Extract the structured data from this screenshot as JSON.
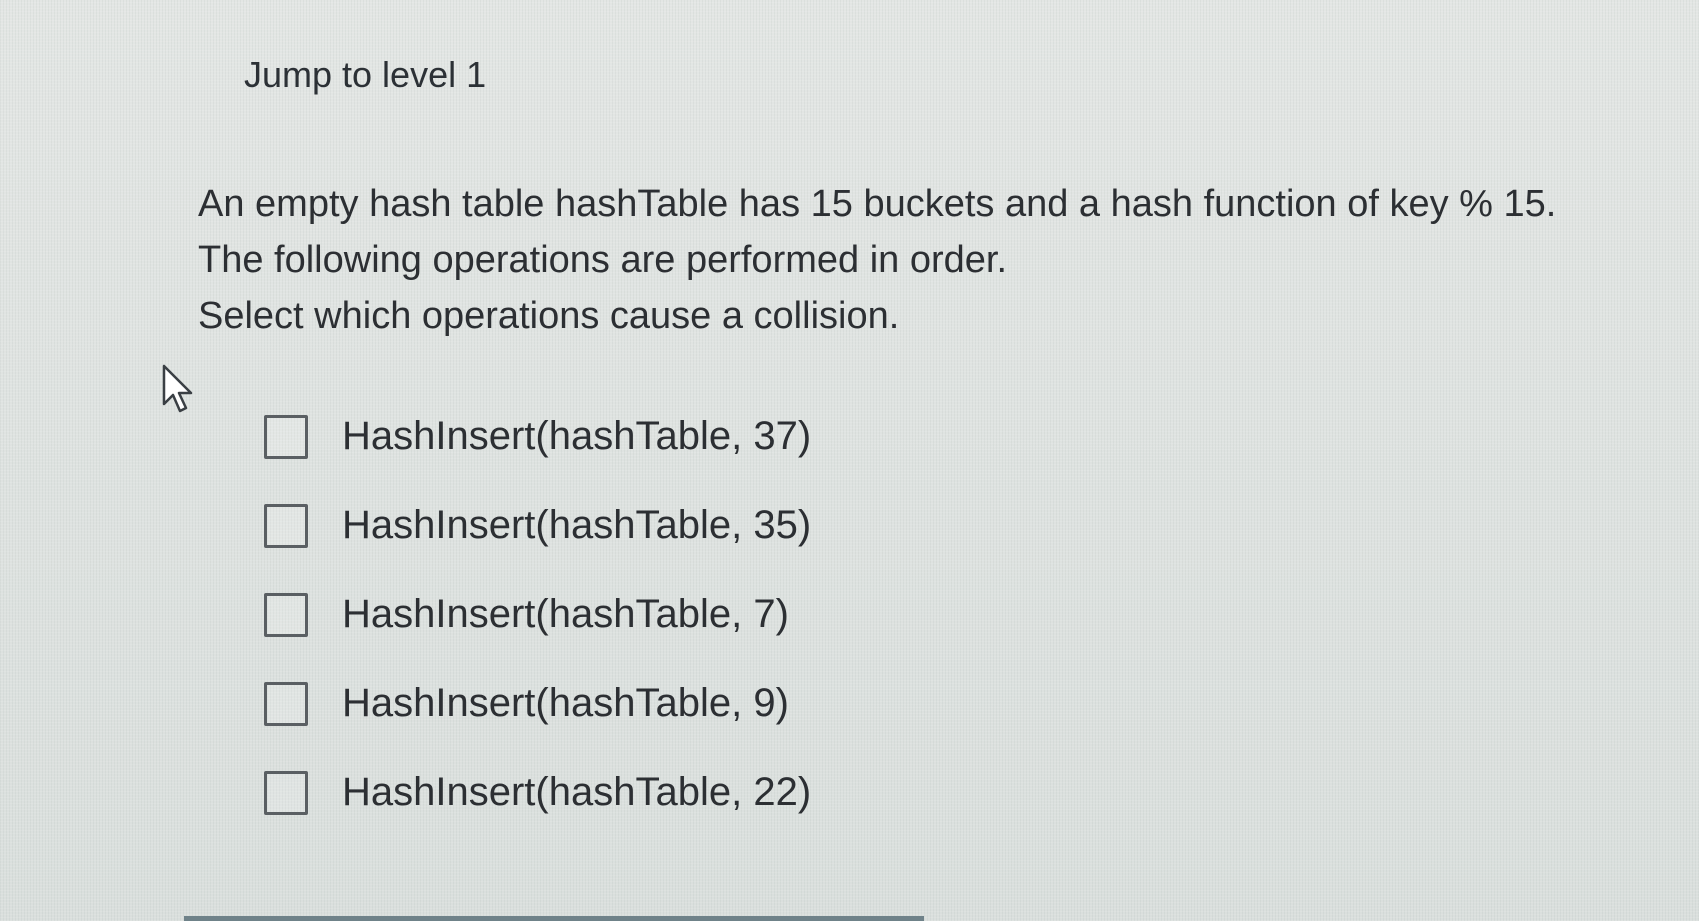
{
  "jump_link": "Jump to level 1",
  "prompt": {
    "line1": "An empty hash table hashTable has 15 buckets and a hash function of key % 15.",
    "line2": "The following operations are performed in order.",
    "line3": "Select which operations cause a collision."
  },
  "options": [
    {
      "label": "HashInsert(hashTable, 37)",
      "checked": false
    },
    {
      "label": "HashInsert(hashTable, 35)",
      "checked": false
    },
    {
      "label": "HashInsert(hashTable, 7)",
      "checked": false
    },
    {
      "label": "HashInsert(hashTable, 9)",
      "checked": false
    },
    {
      "label": "HashInsert(hashTable, 22)",
      "checked": false
    }
  ],
  "icons": {
    "pointer": "mouse-pointer-icon",
    "checkbox": "checkbox-icon"
  },
  "colors": {
    "text": "#2c2f33",
    "checkbox_border": "#5a5f63",
    "background": "#dfe4e2",
    "bottom_bar": "#6f8289"
  }
}
